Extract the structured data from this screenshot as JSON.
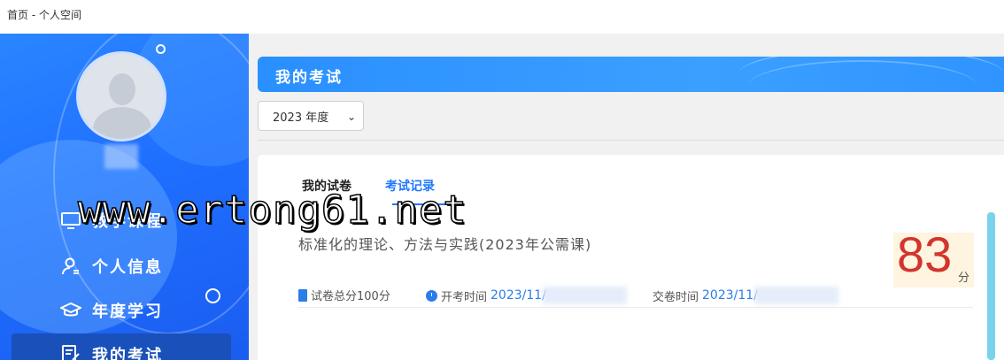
{
  "breadcrumb": "首页 - 个人空间",
  "sidebar": {
    "items": [
      {
        "label": "教学课程",
        "icon": "monitor-icon"
      },
      {
        "label": "个人信息",
        "icon": "user-icon"
      },
      {
        "label": "年度学习",
        "icon": "graduation-cap-icon"
      },
      {
        "label": "我的考试",
        "icon": "exam-edit-icon"
      }
    ],
    "active_index": 3
  },
  "main": {
    "title": "我的考试",
    "year_select": {
      "value": "2023 年度"
    },
    "tabs": [
      {
        "label": "我的试卷",
        "active": false
      },
      {
        "label": "考试记录",
        "active": true
      }
    ],
    "exam": {
      "title": "标准化的理论、方法与实践(2023年公需课)",
      "total_score_label": "试卷总分100分",
      "start_label": "开考时间",
      "start_value": "2023/11/",
      "submit_label": "交卷时间",
      "submit_value": "2023/11/",
      "score": "83",
      "score_unit": "分"
    }
  },
  "watermark": "www.ertong61.net",
  "colors": {
    "accent": "#1e78ff",
    "sidebar_bg": "#2a86ff",
    "score": "#d2352e"
  }
}
